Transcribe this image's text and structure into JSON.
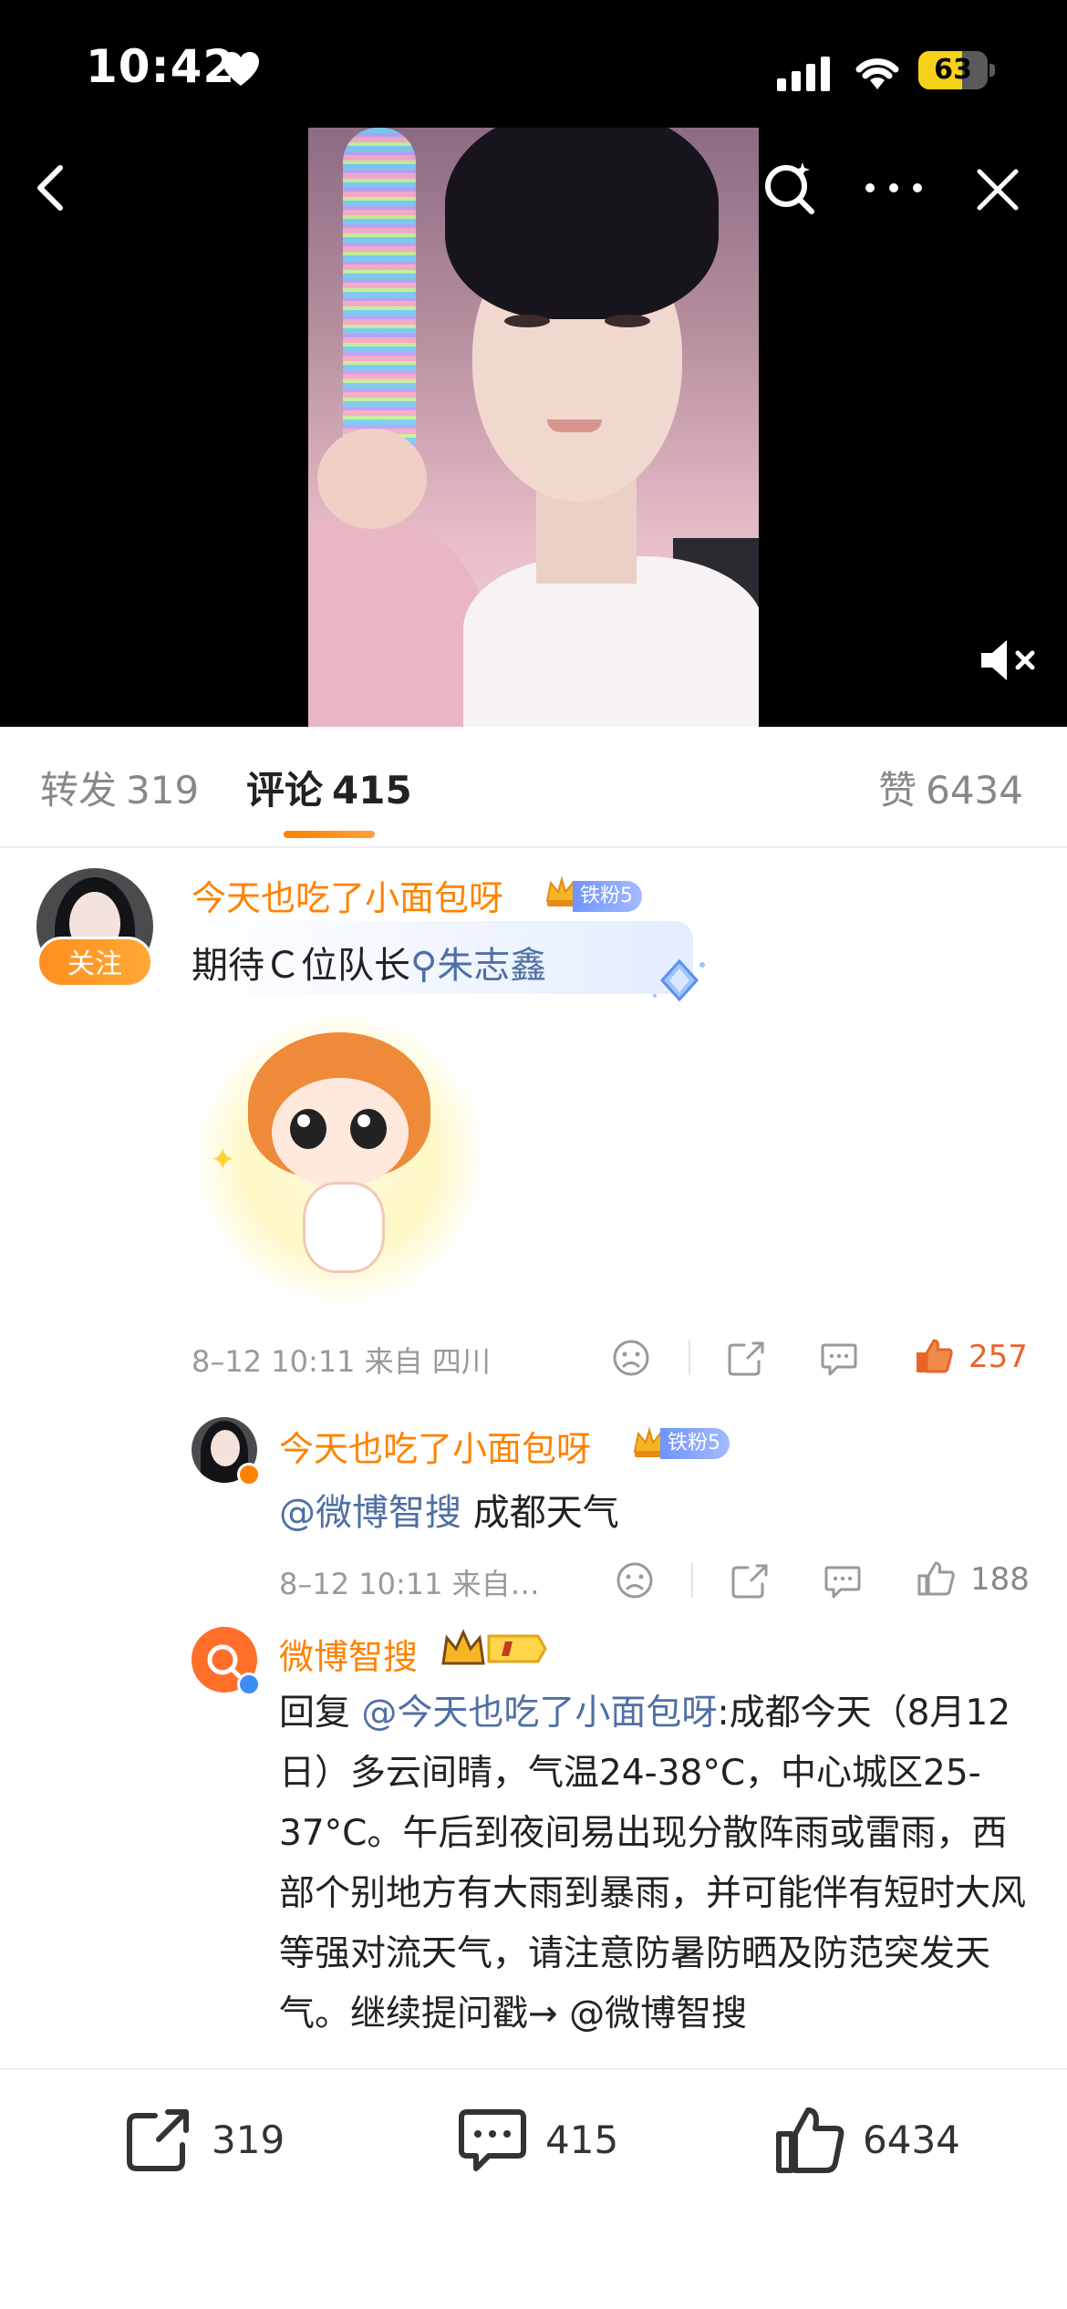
{
  "status_bar": {
    "time": "10:42",
    "battery": "63",
    "battery_level": 0.63
  },
  "colors": {
    "accent": "#ff8200",
    "mention": "#4f6fa5",
    "like_active": "#e8652a"
  },
  "tabs": {
    "repost": {
      "label": "转发",
      "count": "319"
    },
    "comments": {
      "label": "评论",
      "count": "415"
    },
    "likes": {
      "label": "赞",
      "count": "6434"
    }
  },
  "comment": {
    "username": "今天也吃了小面包呀",
    "fan_badge": "铁粉5",
    "follow_label": "关注",
    "text": "期待Ｃ位队长",
    "search_mention": "朱志鑫",
    "time": "8–12 10:11",
    "location": "来自 四川",
    "likes": "257"
  },
  "reply1": {
    "username": "今天也吃了小面包呀",
    "fan_badge": "铁粉5",
    "mention": "@微博智搜",
    "text": " 成都天气",
    "time": "8–12 10:11",
    "location": "来自…",
    "likes": "188"
  },
  "reply2": {
    "username": "微博智搜",
    "reply_prefix": "回复",
    "mention": "@今天也吃了小面包呀",
    "text": ":成都今天（8月12日）多云间晴，气温24-38°C，中心城区25-37°C。午后到夜间易出现分散阵雨或雷雨，西部个别地方有大雨到暴雨，并可能伴有短时大风等强对流天气，请注意防暑防晒及防范突发天气。继续提问戳→ @微博智搜"
  },
  "bottom_bar": {
    "repost_count": "319",
    "comment_count": "415",
    "like_count": "6434"
  },
  "icons": {
    "status": [
      "heart-icon",
      "signal-icon",
      "wifi-icon",
      "battery-icon"
    ],
    "nav": [
      "back-icon",
      "search-icon",
      "more-icon",
      "close-icon"
    ],
    "video": [
      "mute-icon"
    ],
    "actions": [
      "emoji-icon",
      "share-icon",
      "comment-icon",
      "thumb-up-icon"
    ]
  }
}
